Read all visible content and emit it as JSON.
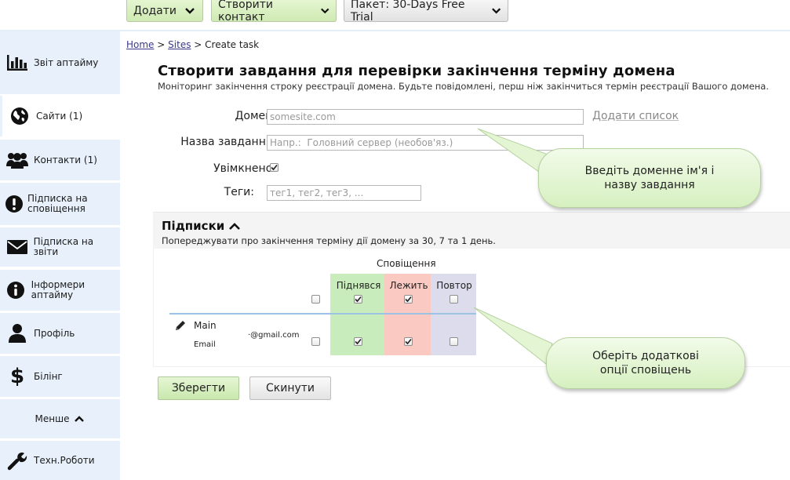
{
  "toolbar": {
    "add_label": "Додати",
    "create_contact_label": "Створити контакт",
    "package_label": "Пакет: 30-Days Free Trial"
  },
  "sidebar": {
    "items": [
      {
        "label": "Звіт аптайму",
        "icon": "bar-chart-icon"
      },
      {
        "label": "Сайти (1)",
        "icon": "globe-icon"
      },
      {
        "label": "Контакти (1)",
        "icon": "users-icon"
      },
      {
        "label": "Підписка на сповіщення",
        "icon": "alert-icon"
      },
      {
        "label": "Підписка на звіти",
        "icon": "envelope-icon"
      },
      {
        "label": "Інформери аптайму",
        "icon": "info-icon"
      },
      {
        "label": "Профіль",
        "icon": "user-icon"
      },
      {
        "label": "Білінг",
        "icon": "dollar-icon"
      },
      {
        "label": "Менше",
        "icon": "chevron-up-icon"
      },
      {
        "label": "Техн.Роботи",
        "icon": "wrench-icon"
      }
    ]
  },
  "breadcrumb": {
    "home": "Home",
    "sep1": ">",
    "sites": "Sites",
    "sep2": ">",
    "current": "Create task"
  },
  "page": {
    "title": "Створити завдання для перевірки закінчення терміну домена",
    "subtitle": "Моніторинг закінчення строку реєстрації домена. Будьте повідомлені, перш ніж закінчиться термін реєстрації Вашого домена."
  },
  "form": {
    "domain_label": "Домен:",
    "domain_placeholder": "somesite.com",
    "add_list_label": "Додати список",
    "task_name_label": "Назва завдання:",
    "task_name_placeholder": "Напр.:  Головний сервер (необов'яз.)",
    "enabled_label": "Увімкнено:",
    "enabled": true,
    "tags_label": "Теги:",
    "tags_placeholder": "тег1, тег2, тег3, ..."
  },
  "subscriptions": {
    "title": "Підписки",
    "description": "Попереджувати про закінчення терміну дії домену за 30, 7 та 1 день.",
    "notifications_header": "Сповіщення",
    "columns": [
      {
        "label": "Піднявся",
        "color": "#c8ecbc"
      },
      {
        "label": "Лежить",
        "color": "#fac9c2"
      },
      {
        "label": "Повтор",
        "color": "#dcdcec"
      }
    ],
    "contact": {
      "name": "Main",
      "type": "Email",
      "email": "·@gmail.com"
    }
  },
  "buttons": {
    "save": "Зберегти",
    "reset": "Скинути"
  },
  "callouts": {
    "domain_hint": "Введіть доменне ім'я  і назву завдання",
    "options_hint": "Оберіть додаткові опції сповіщень"
  },
  "colors": {
    "sidebar_bg": "#e8f1fb",
    "accent_green": "#cfeab3",
    "row_line": "#9cc3e4"
  }
}
